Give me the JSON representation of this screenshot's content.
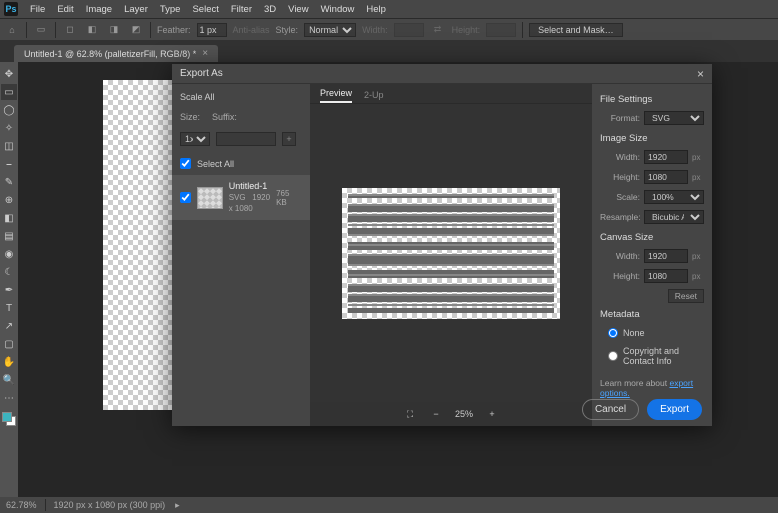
{
  "menubar": [
    "File",
    "Edit",
    "Image",
    "Layer",
    "Type",
    "Select",
    "Filter",
    "3D",
    "View",
    "Window",
    "Help"
  ],
  "options": {
    "feather_label": "Feather:",
    "feather_value": "1 px",
    "antialias": "Anti-alias",
    "style_label": "Style:",
    "style_value": "Normal",
    "width_label": "Width:",
    "height_label": "Height:",
    "select_mask": "Select and Mask…"
  },
  "tab": {
    "title": "Untitled-1 @ 62.8% (palletizerFill, RGB/8) *"
  },
  "status": {
    "zoom": "62.78%",
    "doc": "1920 px x 1080 px (300 ppi)"
  },
  "dialog": {
    "title": "Export As",
    "left": {
      "scale_all": "Scale All",
      "size_label": "Size:",
      "suffix_label": "Suffix:",
      "size_value": "1x",
      "select_all_label": "Select All",
      "asset": {
        "name": "Untitled-1",
        "format": "SVG",
        "dims": "1920 x 1080",
        "filesize": "765 KB"
      }
    },
    "tabs": {
      "preview": "Preview",
      "twoup": "2-Up"
    },
    "zoom": "25%",
    "right": {
      "file_settings": "File Settings",
      "format_label": "Format:",
      "format_value": "SVG",
      "image_size": "Image Size",
      "width_label": "Width:",
      "width_value": "1920",
      "height_label": "Height:",
      "height_value": "1080",
      "scale_label": "Scale:",
      "scale_value": "100%",
      "resample_label": "Resample:",
      "resample_value": "Bicubic Auto…",
      "canvas_size": "Canvas Size",
      "c_width_value": "1920",
      "c_height_value": "1080",
      "reset": "Reset",
      "px": "px",
      "metadata": "Metadata",
      "meta_none": "None",
      "meta_contact": "Copyright and Contact Info",
      "learn_prefix": "Learn more about ",
      "learn_link": "export options."
    },
    "buttons": {
      "cancel": "Cancel",
      "export": "Export"
    }
  }
}
